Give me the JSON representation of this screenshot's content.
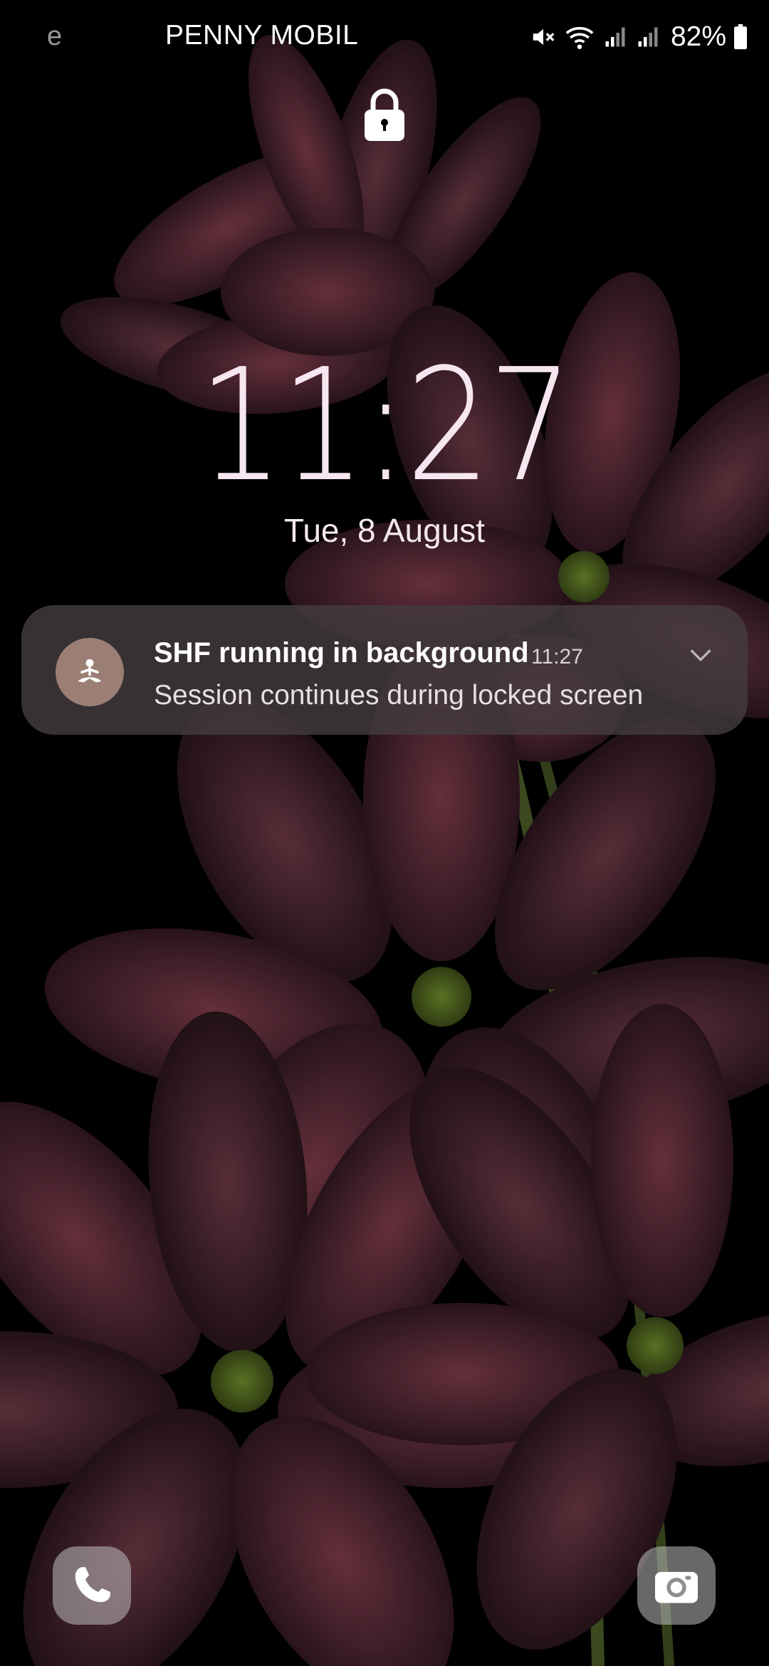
{
  "status_bar": {
    "left_fragment": "e",
    "carrier": "PENNY MOBIL",
    "battery": "82%",
    "icons": [
      "mute-icon",
      "wifi-icon",
      "signal-icon",
      "signal-icon",
      "battery-icon"
    ]
  },
  "lock_screen": {
    "lock_icon": "lock-icon",
    "time": "11:27",
    "date": "Tue, 8 August"
  },
  "notification": {
    "app_icon": "meditation-icon",
    "title": "SHF running in background",
    "time": "11:27",
    "body": "Session continues during locked screen",
    "expand_icon": "chevron-down-icon"
  },
  "shortcuts": {
    "left": "phone-icon",
    "right": "camera-icon"
  },
  "colors": {
    "clock": "#f6e6ef",
    "notification_bg": "#443c40",
    "app_icon_bg": "#9b7f75"
  }
}
